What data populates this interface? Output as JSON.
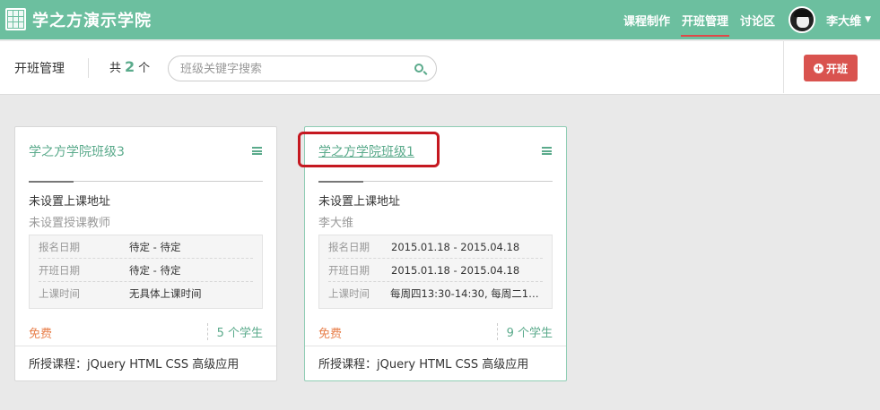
{
  "header": {
    "brand": "学之方演示学院",
    "nav": [
      {
        "label": "课程制作"
      },
      {
        "label": "开班管理",
        "active": true
      },
      {
        "label": "讨论区"
      }
    ],
    "user": {
      "name": "李大维"
    }
  },
  "toolbar": {
    "title": "开班管理",
    "count_prefix": "共",
    "count": "2",
    "count_suffix": "个",
    "search_placeholder": "班级关键字搜索",
    "open_button": "开班"
  },
  "classes": [
    {
      "name": "学之方学院班级3",
      "address": "未设置上课地址",
      "teacher": "未设置授课教师",
      "rows": [
        {
          "key": "报名日期",
          "value": "待定 - 待定"
        },
        {
          "key": "开班日期",
          "value": "待定 - 待定"
        },
        {
          "key": "上课时间",
          "value": "无具体上课时间"
        }
      ],
      "price": "免费",
      "students": "5 个学生",
      "course": "所授课程：jQuery HTML CSS 高级应用"
    },
    {
      "name": "学之方学院班级1",
      "address": "未设置上课地址",
      "teacher": "李大维",
      "rows": [
        {
          "key": "报名日期",
          "value": "2015.01.18 - 2015.04.18"
        },
        {
          "key": "开班日期",
          "value": "2015.01.18 - 2015.04.18"
        },
        {
          "key": "上课时间",
          "value": "每周四13:30-14:30, 每周二13..."
        }
      ],
      "price": "免费",
      "students": "9 个学生",
      "course": "所授课程：jQuery HTML CSS 高级应用"
    }
  ],
  "colors": {
    "header_bg": "#6cbf9f",
    "accent": "#5aaa8b",
    "danger": "#d9534f",
    "price": "#e8804c",
    "highlight": "#c51820"
  }
}
